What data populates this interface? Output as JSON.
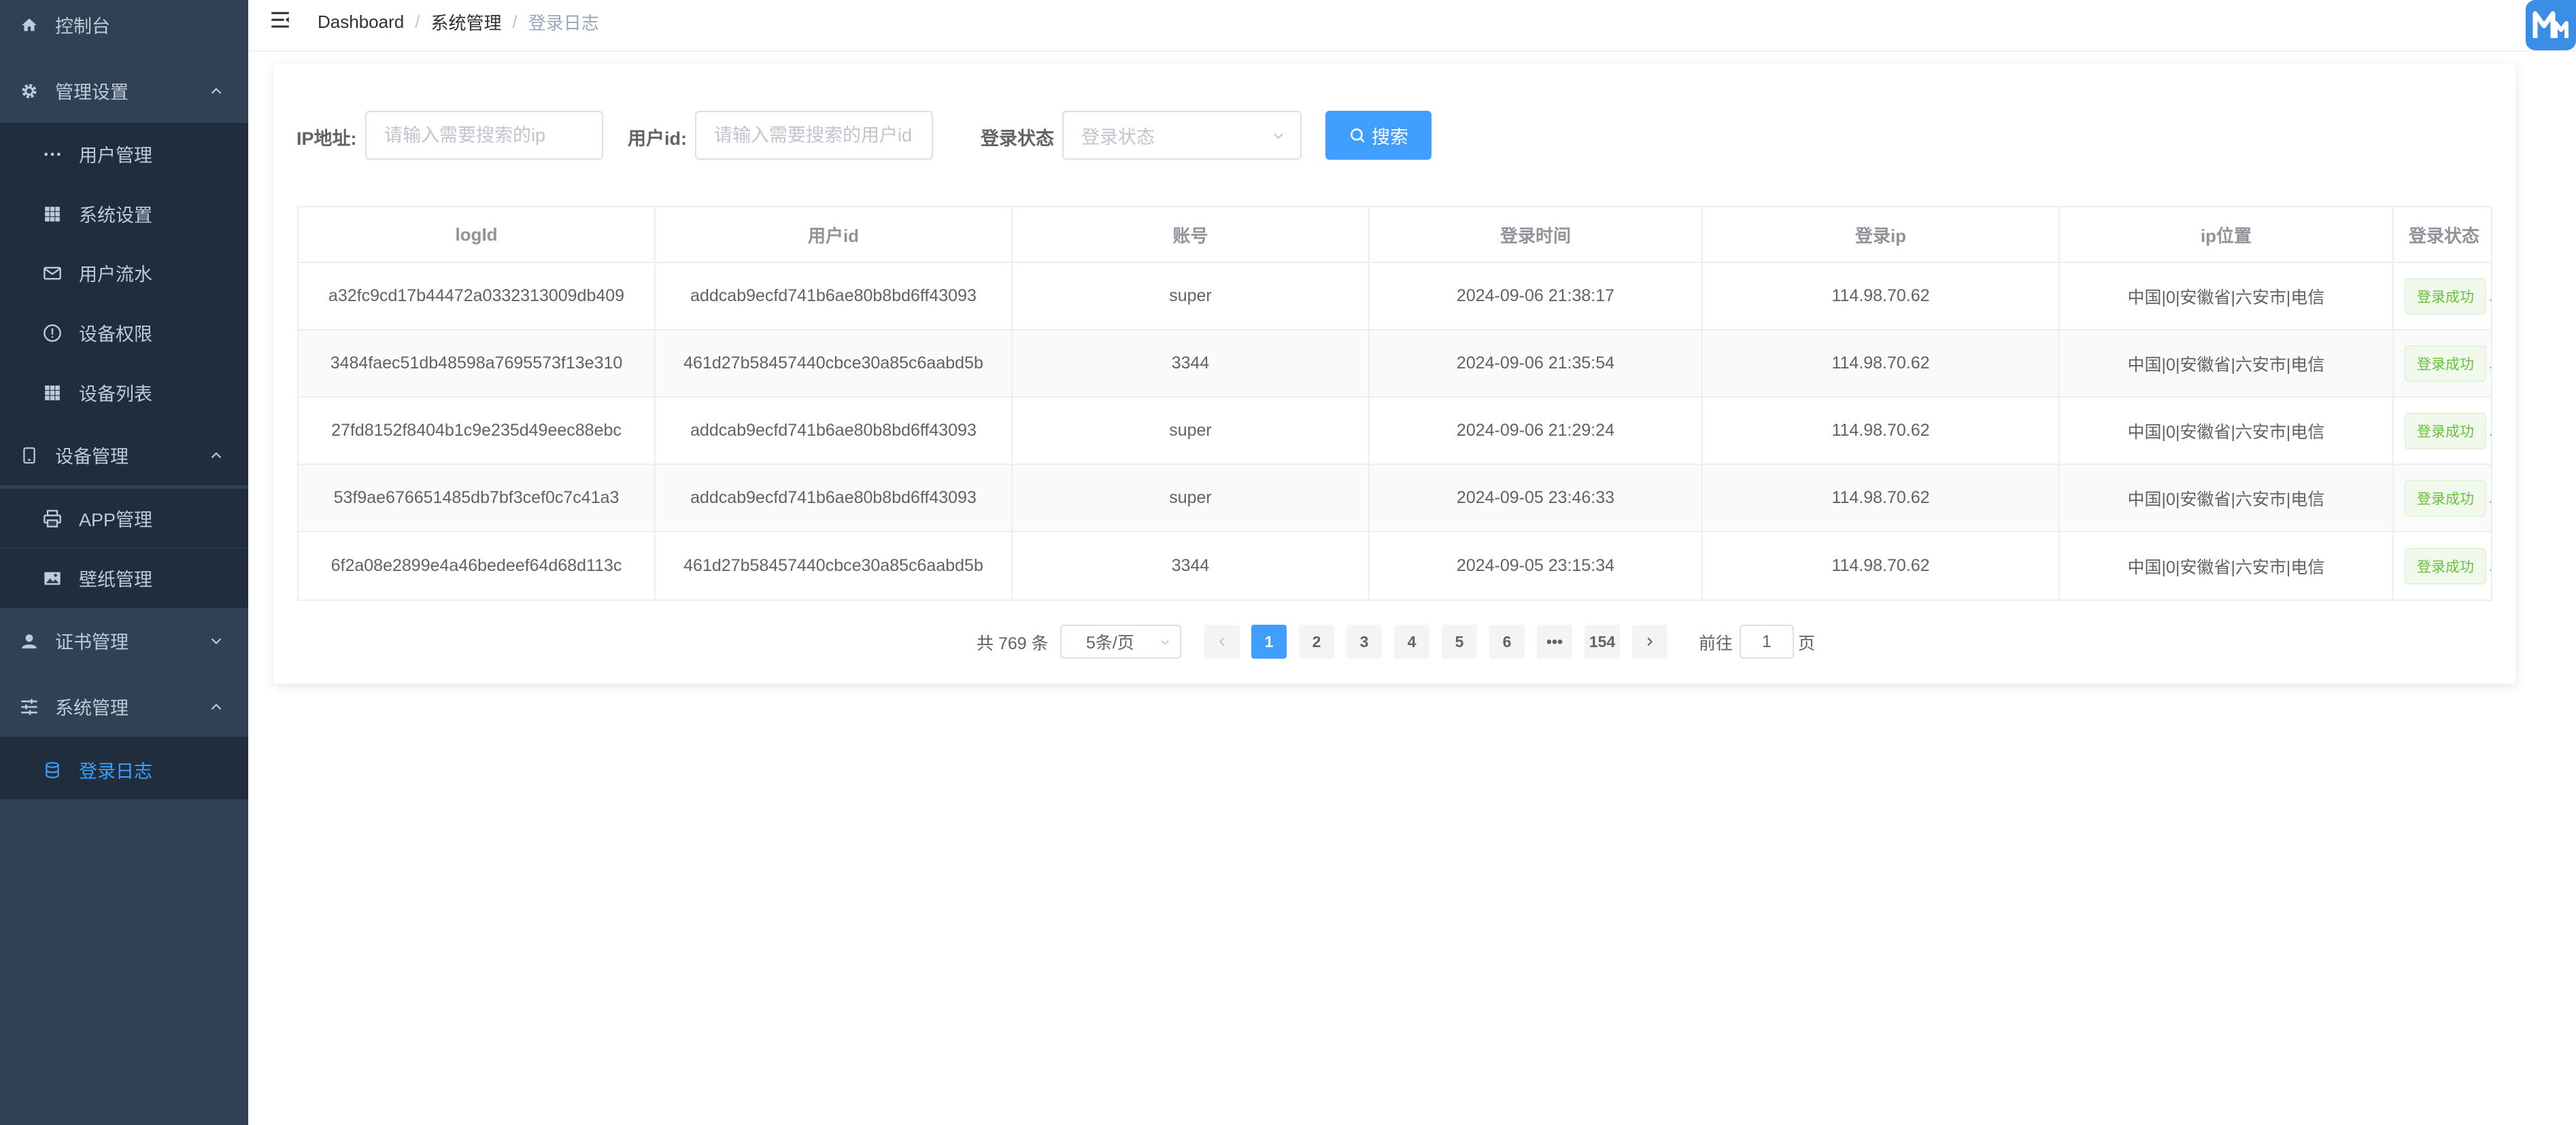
{
  "sidebar": {
    "items": [
      {
        "label": "控制台"
      },
      {
        "label": "管理设置"
      },
      {
        "label": "用户管理"
      },
      {
        "label": "系统设置"
      },
      {
        "label": "用户流水"
      },
      {
        "label": "设备权限"
      },
      {
        "label": "设备列表"
      },
      {
        "label": "设备管理"
      },
      {
        "label": "APP管理"
      },
      {
        "label": "壁纸管理"
      },
      {
        "label": "证书管理"
      },
      {
        "label": "系统管理"
      },
      {
        "label": "登录日志"
      }
    ]
  },
  "breadcrumb": [
    "Dashboard",
    "系统管理",
    "登录日志"
  ],
  "filters": {
    "ip_label": "IP地址:",
    "ip_placeholder": "请输入需要搜索的ip",
    "userid_label": "用户id:",
    "userid_placeholder": "请输入需要搜索的用户id",
    "status_label": "登录状态",
    "status_placeholder": "登录状态",
    "search_label": "搜索"
  },
  "table": {
    "columns": [
      "logId",
      "用户id",
      "账号",
      "登录时间",
      "登录ip",
      "ip位置",
      "登录状态"
    ],
    "rows": [
      [
        "a32fc9cd17b44472a0332313009db409",
        "addcab9ecfd741b6ae80b8bd6ff43093",
        "super",
        "2024-09-06 21:38:17",
        "114.98.70.62",
        "中国|0|安徽省|六安市|电信",
        "登录成功"
      ],
      [
        "3484faec51db48598a7695573f13e310",
        "461d27b58457440cbce30a85c6aabd5b",
        "3344",
        "2024-09-06 21:35:54",
        "114.98.70.62",
        "中国|0|安徽省|六安市|电信",
        "登录成功"
      ],
      [
        "27fd8152f8404b1c9e235d49eec88ebc",
        "addcab9ecfd741b6ae80b8bd6ff43093",
        "super",
        "2024-09-06 21:29:24",
        "114.98.70.62",
        "中国|0|安徽省|六安市|电信",
        "登录成功"
      ],
      [
        "53f9ae676651485db7bf3cef0c7c41a3",
        "addcab9ecfd741b6ae80b8bd6ff43093",
        "super",
        "2024-09-05 23:46:33",
        "114.98.70.62",
        "中国|0|安徽省|六安市|电信",
        "登录成功"
      ],
      [
        "6f2a08e2899e4a46bedeef64d68d113c",
        "461d27b58457440cbce30a85c6aabd5b",
        "3344",
        "2024-09-05 23:15:34",
        "114.98.70.62",
        "中国|0|安徽省|六安市|电信",
        "登录成功"
      ]
    ]
  },
  "pagination": {
    "total": "共 769 条",
    "page_size": "5条/页",
    "pages": [
      "1",
      "2",
      "3",
      "4",
      "5",
      "6",
      "•••",
      "154"
    ],
    "current_page": "1",
    "goto_prefix": "前往",
    "goto_value": "1",
    "goto_suffix": "页"
  },
  "icons": {
    "home": "home-icon",
    "gear": "gear-icon",
    "dots": "dots-icon",
    "grid": "grid-icon",
    "mail": "mail-icon",
    "info": "info-circle-icon",
    "mobile": "mobile-icon",
    "printer": "printer-icon",
    "picture": "picture-icon",
    "user": "user-icon",
    "sliders": "sliders-icon",
    "database": "database-icon",
    "search": "search-icon",
    "hamburger": "hamburger-icon",
    "chevron": "chevron-icon"
  },
  "colors": {
    "sidebar_bg": "#304156",
    "submenu_bg": "#1f2d3d",
    "menu_text": "#bfcbd9",
    "primary": "#409eff",
    "success": "#67c23a"
  }
}
